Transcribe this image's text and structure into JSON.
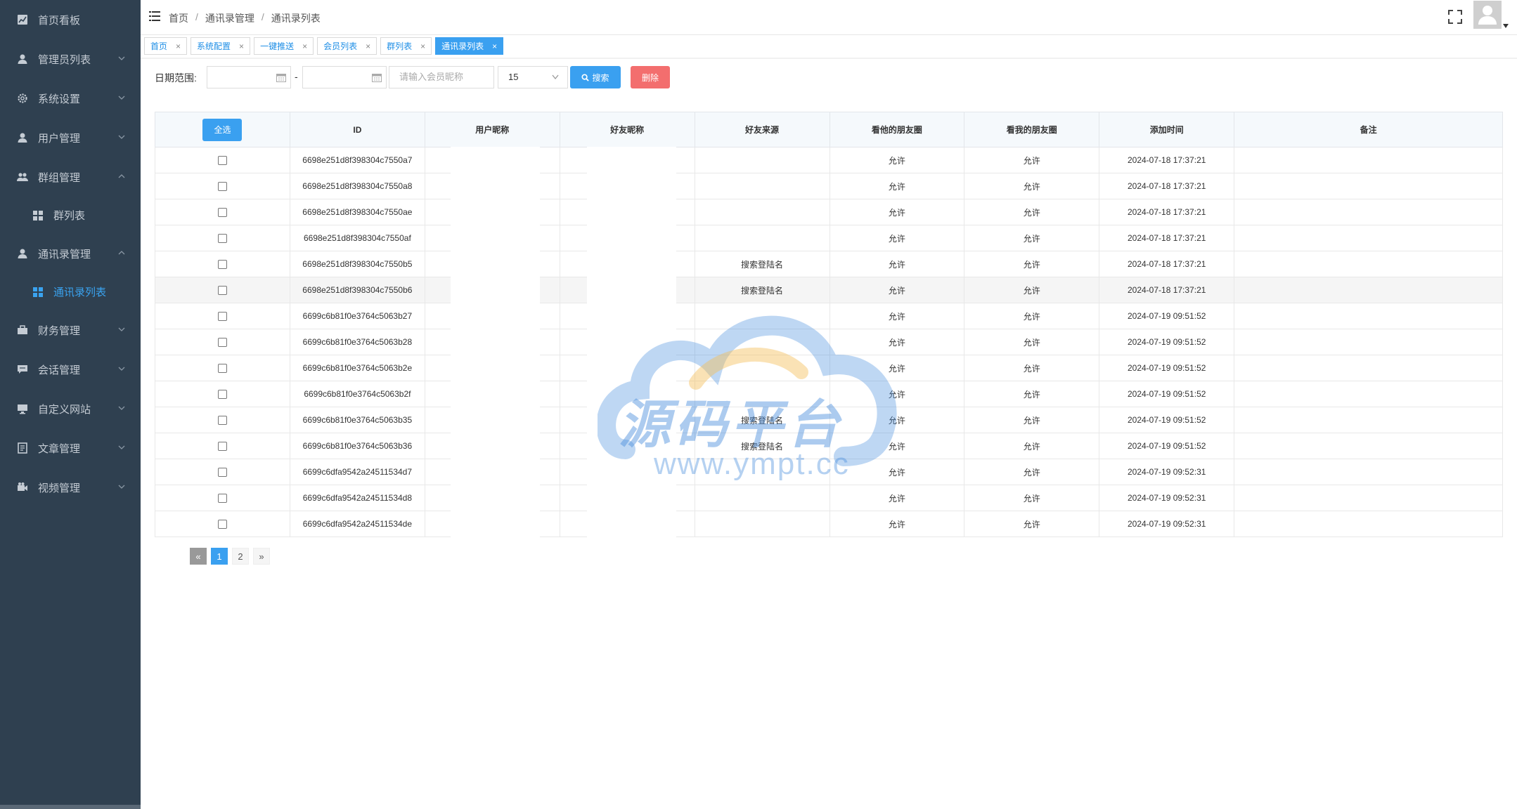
{
  "sidebar": {
    "items": [
      {
        "label": "首页看板",
        "icon": "chart-icon",
        "chev": ""
      },
      {
        "label": "管理员列表",
        "icon": "user-icon",
        "chev": "down"
      },
      {
        "label": "系统设置",
        "icon": "gear-icon",
        "chev": "down"
      },
      {
        "label": "用户管理",
        "icon": "user-icon",
        "chev": "down"
      },
      {
        "label": "群组管理",
        "icon": "group-icon",
        "chev": "up"
      },
      {
        "label": "群列表",
        "icon": "grid-icon",
        "sub": true
      },
      {
        "label": "通讯录管理",
        "icon": "user-icon",
        "chev": "up"
      },
      {
        "label": "通讯录列表",
        "icon": "grid-icon",
        "sub": true,
        "active": true
      },
      {
        "label": "财务管理",
        "icon": "briefcase-icon",
        "chev": "down"
      },
      {
        "label": "会话管理",
        "icon": "chat-icon",
        "chev": "down"
      },
      {
        "label": "自定义网站",
        "icon": "monitor-icon",
        "chev": "down"
      },
      {
        "label": "文章管理",
        "icon": "document-icon",
        "chev": "down"
      },
      {
        "label": "视频管理",
        "icon": "video-icon",
        "chev": "down"
      }
    ]
  },
  "breadcrumb": [
    "首页",
    "通讯录管理",
    "通讯录列表"
  ],
  "tabs": [
    {
      "label": "首页"
    },
    {
      "label": "系统配置"
    },
    {
      "label": "一键推送"
    },
    {
      "label": "会员列表"
    },
    {
      "label": "群列表"
    },
    {
      "label": "通讯录列表",
      "active": true
    }
  ],
  "tab_close": "×",
  "filters": {
    "date_label": "日期范围:",
    "dash": "-",
    "nickname_placeholder": "请输入会员昵称",
    "page_size": "15",
    "search_label": "搜索",
    "delete_label": "删除"
  },
  "table": {
    "select_all": "全选",
    "headers": [
      "ID",
      "用户昵称",
      "好友昵称",
      "好友来源",
      "看他的朋友圈",
      "看我的朋友圈",
      "添加时间",
      "备注"
    ],
    "rows": [
      {
        "id": "6698e251d8f398304c7550a7",
        "source": "",
        "his": "允许",
        "mine": "允许",
        "time": "2024-07-18 17:37:21",
        "note": ""
      },
      {
        "id": "6698e251d8f398304c7550a8",
        "source": "",
        "his": "允许",
        "mine": "允许",
        "time": "2024-07-18 17:37:21",
        "note": ""
      },
      {
        "id": "6698e251d8f398304c7550ae",
        "source": "",
        "his": "允许",
        "mine": "允许",
        "time": "2024-07-18 17:37:21",
        "note": ""
      },
      {
        "id": "6698e251d8f398304c7550af",
        "source": "",
        "his": "允许",
        "mine": "允许",
        "time": "2024-07-18 17:37:21",
        "note": ""
      },
      {
        "id": "6698e251d8f398304c7550b5",
        "source": "搜索登陆名",
        "his": "允许",
        "mine": "允许",
        "time": "2024-07-18 17:37:21",
        "note": ""
      },
      {
        "id": "6698e251d8f398304c7550b6",
        "source": "搜索登陆名",
        "his": "允许",
        "mine": "允许",
        "time": "2024-07-18 17:37:21",
        "note": "",
        "highlight": true
      },
      {
        "id": "6699c6b81f0e3764c5063b27",
        "source": "",
        "his": "允许",
        "mine": "允许",
        "time": "2024-07-19 09:51:52",
        "note": ""
      },
      {
        "id": "6699c6b81f0e3764c5063b28",
        "source": "",
        "his": "允许",
        "mine": "允许",
        "time": "2024-07-19 09:51:52",
        "note": ""
      },
      {
        "id": "6699c6b81f0e3764c5063b2e",
        "source": "",
        "his": "允许",
        "mine": "允许",
        "time": "2024-07-19 09:51:52",
        "note": ""
      },
      {
        "id": "6699c6b81f0e3764c5063b2f",
        "source": "",
        "his": "允许",
        "mine": "允许",
        "time": "2024-07-19 09:51:52",
        "note": ""
      },
      {
        "id": "6699c6b81f0e3764c5063b35",
        "source": "搜索登陆名",
        "his": "允许",
        "mine": "允许",
        "time": "2024-07-19 09:51:52",
        "note": ""
      },
      {
        "id": "6699c6b81f0e3764c5063b36",
        "source": "搜索登陆名",
        "his": "允许",
        "mine": "允许",
        "time": "2024-07-19 09:51:52",
        "note": ""
      },
      {
        "id": "6699c6dfa9542a24511534d7",
        "source": "",
        "his": "允许",
        "mine": "允许",
        "time": "2024-07-19 09:52:31",
        "note": ""
      },
      {
        "id": "6699c6dfa9542a24511534d8",
        "source": "",
        "his": "允许",
        "mine": "允许",
        "time": "2024-07-19 09:52:31",
        "note": ""
      },
      {
        "id": "6699c6dfa9542a24511534de",
        "source": "",
        "his": "允许",
        "mine": "允许",
        "time": "2024-07-19 09:52:31",
        "note": ""
      }
    ]
  },
  "pagination": {
    "prev": "«",
    "pages": [
      "1",
      "2"
    ],
    "current": "1",
    "next": "»"
  },
  "watermark": {
    "text": "源码平台",
    "url": "www.ympt.cc"
  },
  "colors": {
    "sidebar_bg": "#2f4050",
    "primary": "#3aa0f0",
    "danger": "#f36e6e"
  }
}
